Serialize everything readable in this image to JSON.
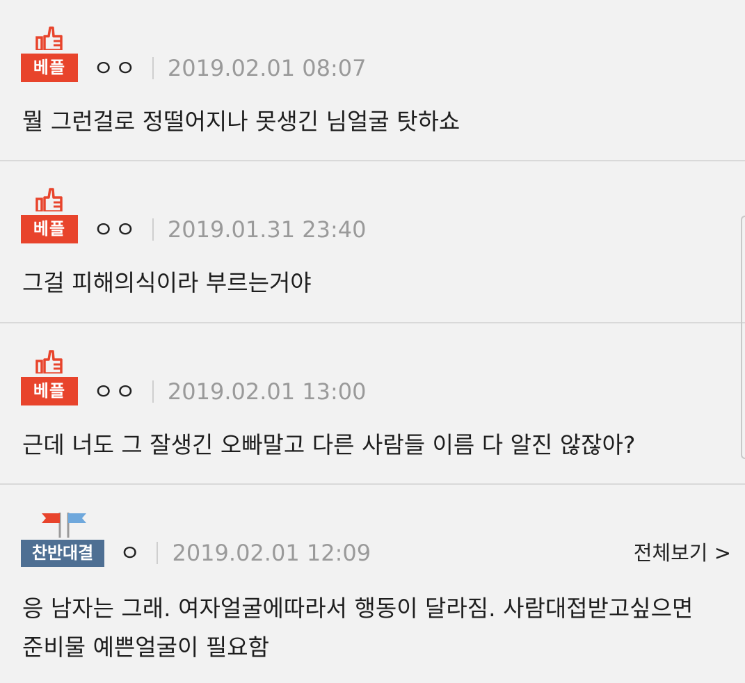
{
  "comments": [
    {
      "badge": "베플",
      "author": "ㅇㅇ",
      "date": "2019.02.01 08:07",
      "text": "뭘 그런걸로 정떨어지나 못생긴 님얼굴 탓하쇼"
    },
    {
      "badge": "베플",
      "author": "ㅇㅇ",
      "date": "2019.01.31 23:40",
      "text": "그걸 피해의식이라 부르는거야"
    },
    {
      "badge": "베플",
      "author": "ㅇㅇ",
      "date": "2019.02.01 13:00",
      "text": "근데 너도 그 잘생긴 오빠말고 다른 사람들 이름 다 알진 않잖아?"
    },
    {
      "badge": "찬반대결",
      "author": "ㅇ",
      "date": "2019.02.01 12:09",
      "view_all": "전체보기 >",
      "text_line1": "응 남자는 그래. 여자얼굴에따라서 행동이 달라짐. 사람대접받고싶으면",
      "text_line2": "준비물 예쁜얼굴이 필요함"
    }
  ],
  "icons": {
    "best_badge": "thumbs-up-icon",
    "debate_badge": "flags-icon"
  },
  "colors": {
    "best_badge": "#e8442c",
    "debate_badge": "#4e6f93",
    "flag_red": "#e8442c",
    "flag_blue": "#6fa8dc",
    "background": "#f2f2f2",
    "date_text": "#9a9a9a"
  }
}
